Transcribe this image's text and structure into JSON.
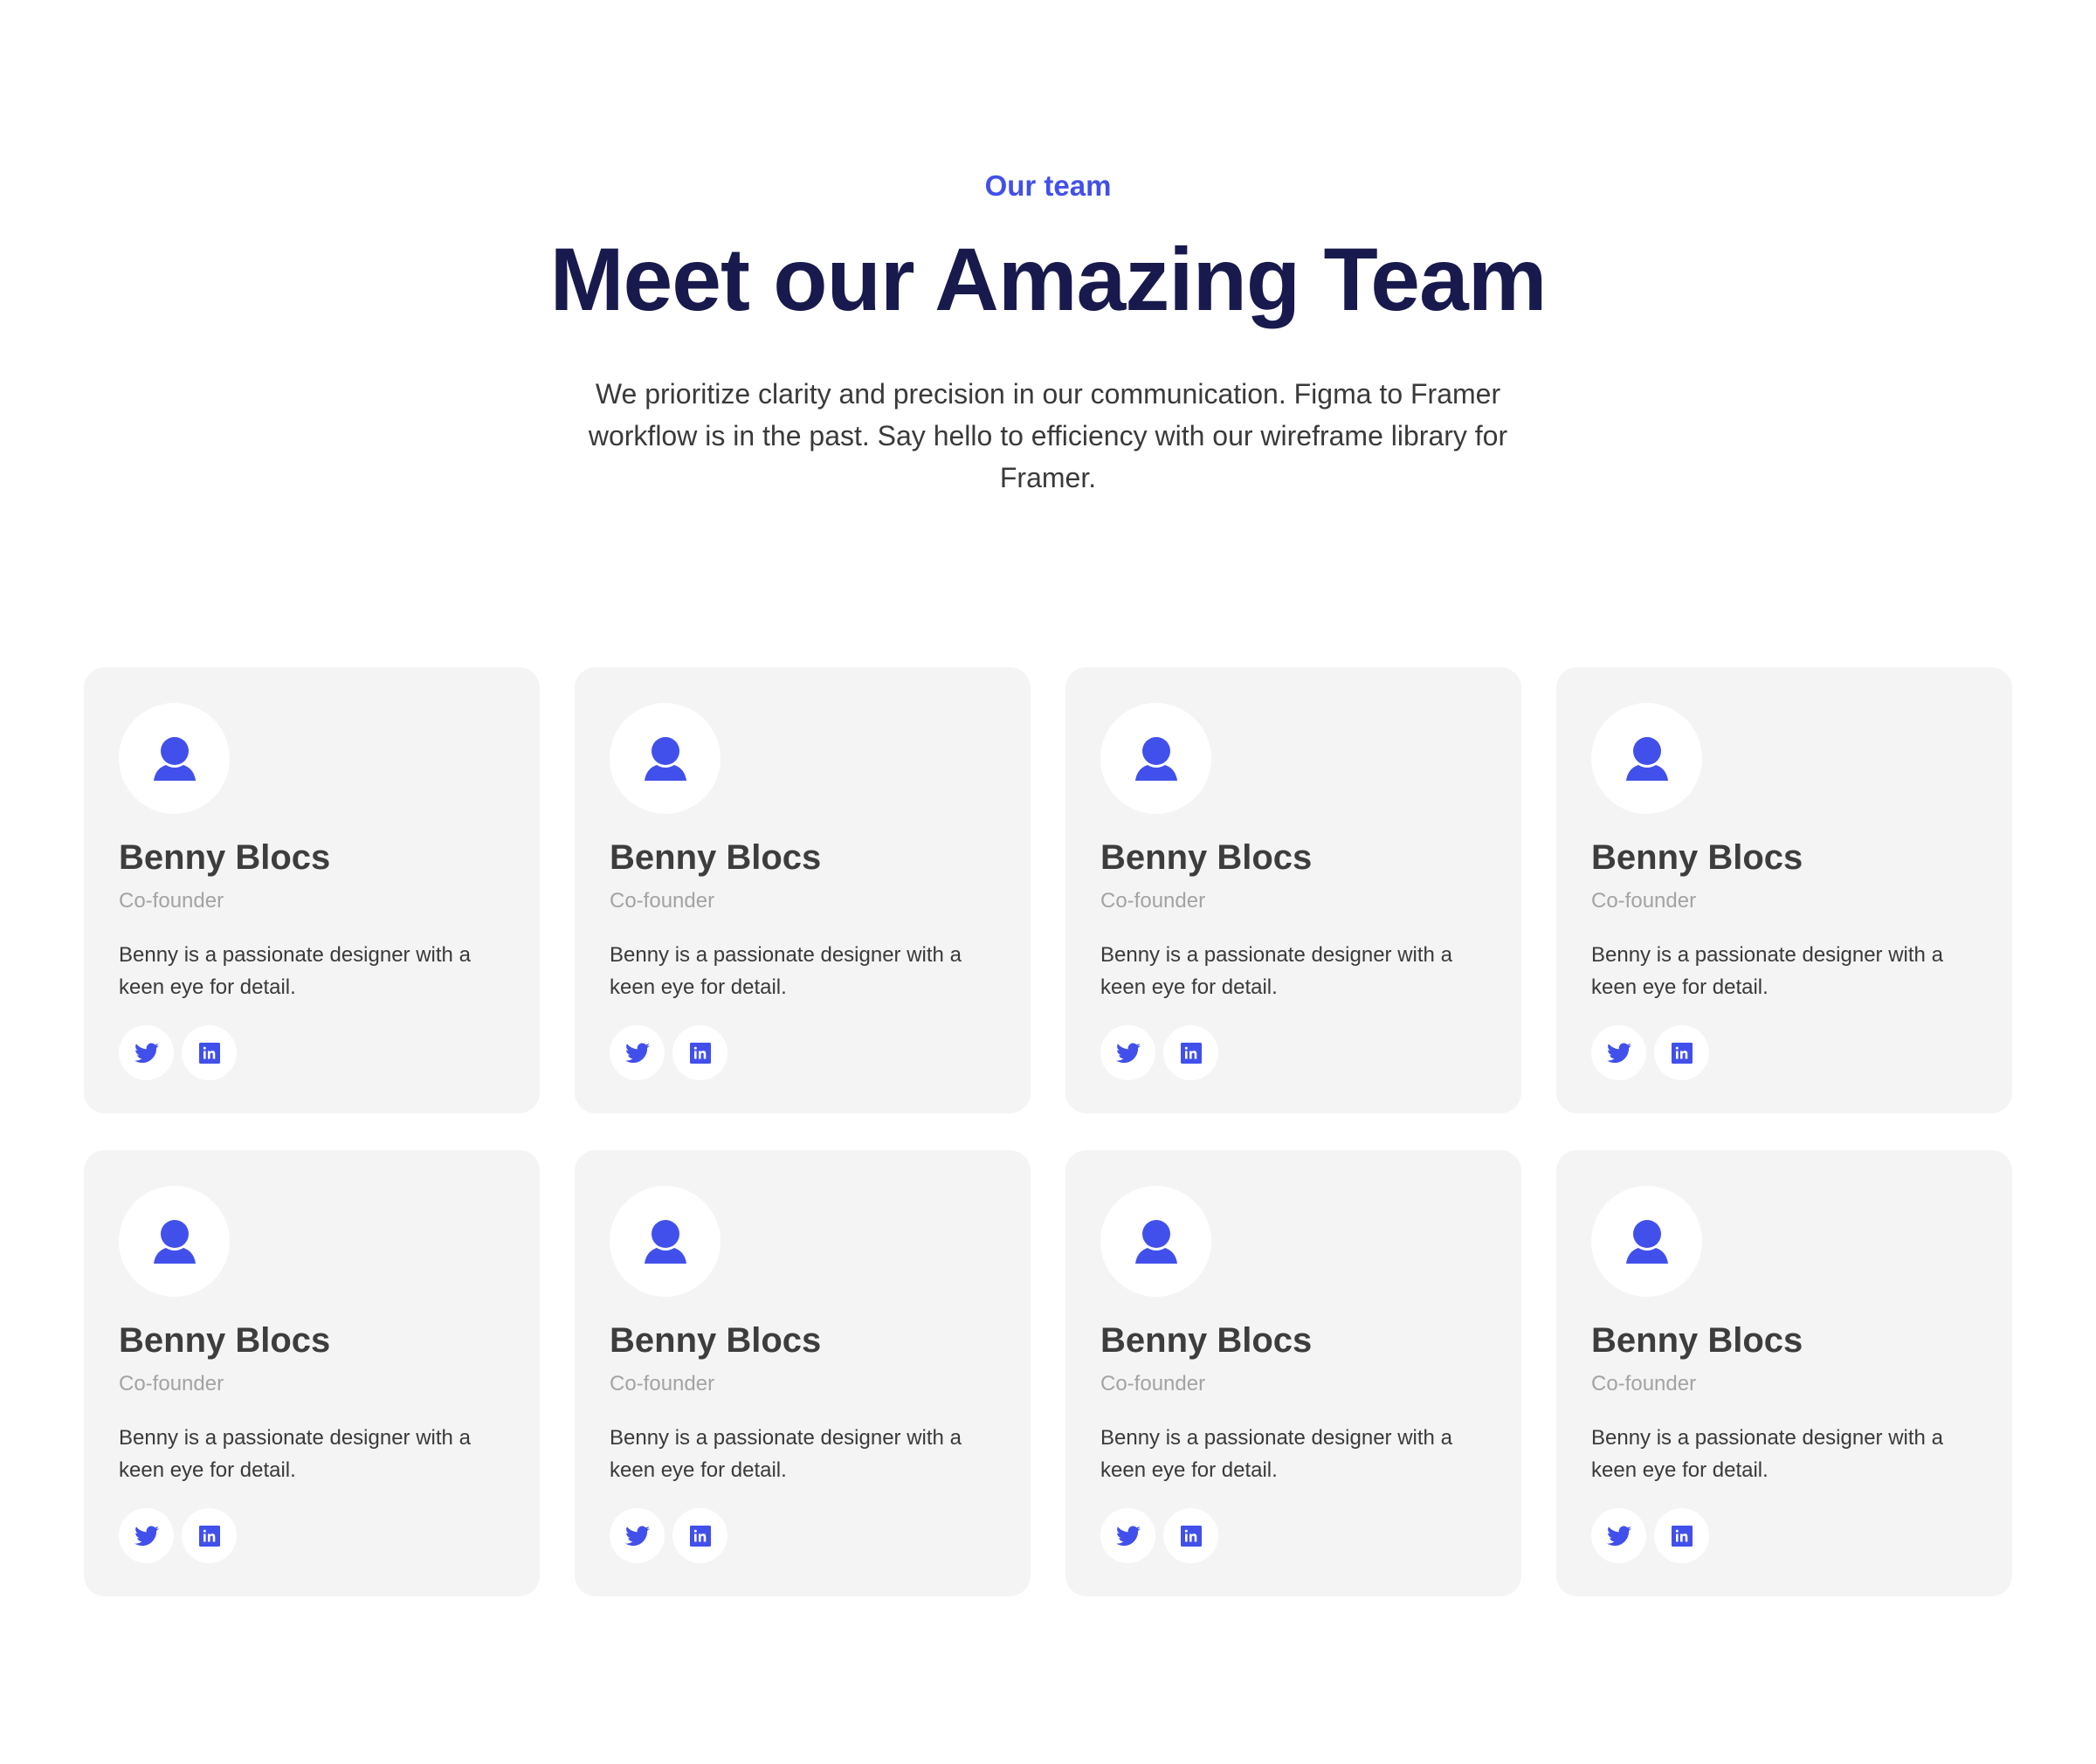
{
  "header": {
    "eyebrow": "Our team",
    "title": "Meet our Amazing Team",
    "lead": "We prioritize clarity and precision in our communication. Figma to Framer workflow is in the past. Say hello to efficiency with our wireframe library for Framer."
  },
  "colors": {
    "accent": "#4150eb",
    "title": "#181a4d",
    "card_bg": "#f4f4f4"
  },
  "members": [
    {
      "name": "Benny Blocs",
      "role": "Co-founder",
      "bio": "Benny is a passionate designer with a keen eye for detail.",
      "icons": [
        "user-icon",
        "twitter-icon",
        "linkedin-icon"
      ]
    },
    {
      "name": "Benny Blocs",
      "role": "Co-founder",
      "bio": "Benny is a passionate designer with a keen eye for detail.",
      "icons": [
        "user-icon",
        "twitter-icon",
        "linkedin-icon"
      ]
    },
    {
      "name": "Benny Blocs",
      "role": "Co-founder",
      "bio": "Benny is a passionate designer with a keen eye for detail.",
      "icons": [
        "user-icon",
        "twitter-icon",
        "linkedin-icon"
      ]
    },
    {
      "name": "Benny Blocs",
      "role": "Co-founder",
      "bio": "Benny is a passionate designer with a keen eye for detail.",
      "icons": [
        "user-icon",
        "twitter-icon",
        "linkedin-icon"
      ]
    },
    {
      "name": "Benny Blocs",
      "role": "Co-founder",
      "bio": "Benny is a passionate designer with a keen eye for detail.",
      "icons": [
        "user-icon",
        "twitter-icon",
        "linkedin-icon"
      ]
    },
    {
      "name": "Benny Blocs",
      "role": "Co-founder",
      "bio": "Benny is a passionate designer with a keen eye for detail.",
      "icons": [
        "user-icon",
        "twitter-icon",
        "linkedin-icon"
      ]
    },
    {
      "name": "Benny Blocs",
      "role": "Co-founder",
      "bio": "Benny is a passionate designer with a keen eye for detail.",
      "icons": [
        "user-icon",
        "twitter-icon",
        "linkedin-icon"
      ]
    },
    {
      "name": "Benny Blocs",
      "role": "Co-founder",
      "bio": "Benny is a passionate designer with a keen eye for detail.",
      "icons": [
        "user-icon",
        "twitter-icon",
        "linkedin-icon"
      ]
    }
  ]
}
